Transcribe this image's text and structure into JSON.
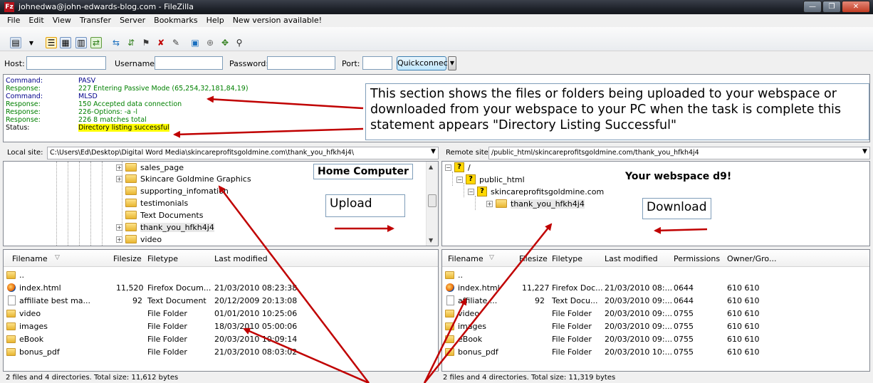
{
  "window": {
    "title": "johnedwa@john-edwards-blog.com - FileZilla",
    "app_icon_text": "Fz",
    "controls": [
      "minimize",
      "maximize",
      "close"
    ]
  },
  "menu": [
    "File",
    "Edit",
    "View",
    "Transfer",
    "Server",
    "Bookmarks",
    "Help",
    "New version available!"
  ],
  "toolbar_icons": [
    "site-manager-icon",
    "dropdown-arrow-icon",
    "toggle-log-icon",
    "toggle-local-tree-icon",
    "toggle-remote-tree-icon",
    "toggle-queue-icon",
    "refresh-icon",
    "process-queue-icon",
    "cancel-icon",
    "disconnect-icon",
    "reconnect-icon",
    "filter-icon",
    "compare-icon",
    "sync-browse-icon",
    "search-icon"
  ],
  "quickconnect": {
    "host_label": "Host:",
    "host_value": "",
    "username_label": "Username:",
    "username_value": "",
    "password_label": "Password:",
    "password_value": "",
    "port_label": "Port:",
    "port_value": "",
    "button_label": "Quickconnect",
    "dropdown_glyph": "▼"
  },
  "log": [
    {
      "type": "Command:",
      "text": "PASV",
      "kind": "command"
    },
    {
      "type": "Response:",
      "text": "227 Entering Passive Mode (65,254,32,181,84,19)",
      "kind": "response"
    },
    {
      "type": "Command:",
      "text": "MLSD",
      "kind": "command"
    },
    {
      "type": "Response:",
      "text": "150 Accepted data connection",
      "kind": "response"
    },
    {
      "type": "Response:",
      "text": "226-Options: -a -l",
      "kind": "response"
    },
    {
      "type": "Response:",
      "text": "226 8 matches total",
      "kind": "response"
    },
    {
      "type": "Status:",
      "text": "Directory listing successful",
      "kind": "status"
    }
  ],
  "annotations": {
    "log_callout": "This section shows the files or folders being uploaded to your webspace or downloaded from your webspace to your PC when the task is complete this statement appears \"Directory Listing Successful\"",
    "home_computer": "Home Computer",
    "upload": "Upload",
    "your_webspace": "Your webspace  d9!",
    "download": "Download"
  },
  "local": {
    "site_label": "Local site:",
    "path": "C:\\Users\\Ed\\Desktop\\Digital Word Media\\skincareprofitsgoldmine.com\\thank_you_hfkh4j4\\",
    "tree": [
      {
        "name": "sales_page",
        "expandable": true
      },
      {
        "name": "Skincare Goldmine Graphics",
        "expandable": true
      },
      {
        "name": "supporting_infomation",
        "expandable": false
      },
      {
        "name": "testimonials",
        "expandable": false
      },
      {
        "name": "Text Documents",
        "expandable": false
      },
      {
        "name": "thank_you_hfkh4j4",
        "expandable": true
      },
      {
        "name": "video",
        "expandable": true
      }
    ],
    "columns": [
      "Filename",
      "Filesize",
      "Filetype",
      "Last modified"
    ],
    "files": [
      {
        "name": "..",
        "size": "",
        "type": "",
        "modified": "",
        "icon": "folder"
      },
      {
        "name": "index.html",
        "size": "11,520",
        "type": "Firefox Docum...",
        "modified": "21/03/2010 08:23:38",
        "icon": "ff"
      },
      {
        "name": "affiliate best ma...",
        "size": "92",
        "type": "Text Document",
        "modified": "20/12/2009 20:13:08",
        "icon": "doc"
      },
      {
        "name": "video",
        "size": "",
        "type": "File Folder",
        "modified": "01/01/2010 10:25:06",
        "icon": "folder"
      },
      {
        "name": "images",
        "size": "",
        "type": "File Folder",
        "modified": "18/03/2010 05:00:06",
        "icon": "folder"
      },
      {
        "name": "eBook",
        "size": "",
        "type": "File Folder",
        "modified": "20/03/2010 10:09:14",
        "icon": "folder"
      },
      {
        "name": "bonus_pdf",
        "size": "",
        "type": "File Folder",
        "modified": "21/03/2010 08:03:02",
        "icon": "folder"
      }
    ],
    "status": "2 files and 4 directories. Total size: 11,612 bytes"
  },
  "remote": {
    "site_label": "Remote site:",
    "path": "/public_html/skincareprofitsgoldmine.com/thank_you_hfkh4j4",
    "tree": [
      {
        "name": "/",
        "icon": "question"
      },
      {
        "name": "public_html",
        "icon": "question"
      },
      {
        "name": "skincareprofitsgoldmine.com",
        "icon": "question"
      },
      {
        "name": "thank_you_hfkh4j4",
        "icon": "folder"
      }
    ],
    "columns": [
      "Filename",
      "Filesize",
      "Filetype",
      "Last modified",
      "Permissions",
      "Owner/Gro..."
    ],
    "files": [
      {
        "name": "..",
        "size": "",
        "type": "",
        "modified": "",
        "perms": "",
        "owner": "",
        "icon": "folder"
      },
      {
        "name": "index.html",
        "size": "11,227",
        "type": "Firefox Doc...",
        "modified": "21/03/2010 08:...",
        "perms": "0644",
        "owner": "610 610",
        "icon": "ff"
      },
      {
        "name": "affiliate ...",
        "size": "92",
        "type": "Text Docu...",
        "modified": "20/03/2010 09:...",
        "perms": "0644",
        "owner": "610 610",
        "icon": "doc"
      },
      {
        "name": "video",
        "size": "",
        "type": "File Folder",
        "modified": "20/03/2010 09:...",
        "perms": "0755",
        "owner": "610 610",
        "icon": "folder"
      },
      {
        "name": "images",
        "size": "",
        "type": "File Folder",
        "modified": "20/03/2010 09:...",
        "perms": "0755",
        "owner": "610 610",
        "icon": "folder"
      },
      {
        "name": "eBook",
        "size": "",
        "type": "File Folder",
        "modified": "20/03/2010 09:...",
        "perms": "0755",
        "owner": "610 610",
        "icon": "folder"
      },
      {
        "name": "bonus_pdf",
        "size": "",
        "type": "File Folder",
        "modified": "20/03/2010 10:...",
        "perms": "0755",
        "owner": "610 610",
        "icon": "folder"
      }
    ],
    "status": "2 files and 4 directories. Total size: 11,319 bytes"
  },
  "colors": {
    "command": "#00008b",
    "response": "#008000",
    "status_highlight": "#ffff00",
    "arrow": "#c00000"
  }
}
